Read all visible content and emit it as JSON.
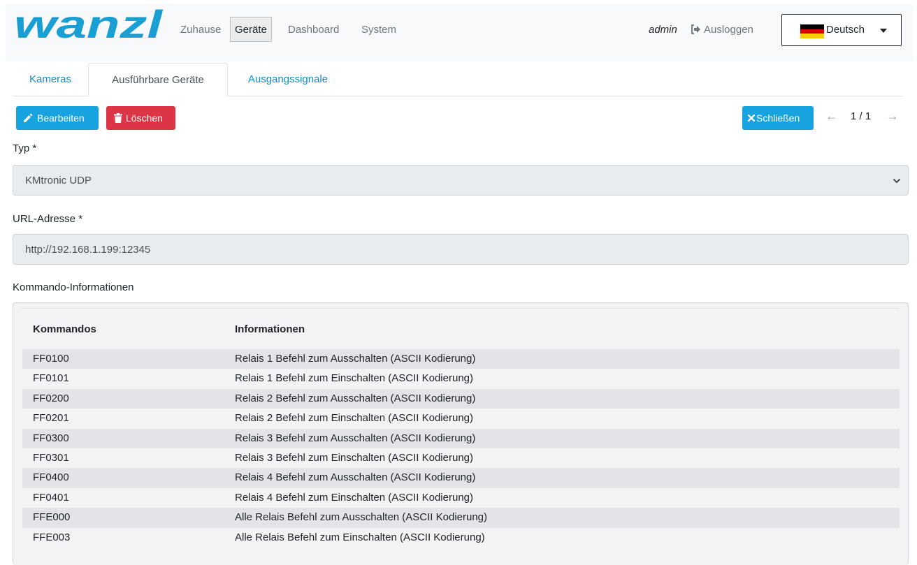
{
  "brand": {
    "logo_text": "wanzl",
    "color": "#1a9fd4"
  },
  "nav": {
    "links": [
      {
        "label": "Zuhause",
        "active": false
      },
      {
        "label": "Geräte",
        "active": true
      },
      {
        "label": "Dashboard",
        "active": false
      },
      {
        "label": "System",
        "active": false
      }
    ],
    "user": "admin",
    "logout_label": "Ausloggen",
    "language_label": "Deutsch"
  },
  "tabs": [
    {
      "label": "Kameras",
      "active": false
    },
    {
      "label": "Ausführbare Geräte",
      "active": true
    },
    {
      "label": "Ausgangssignale",
      "active": false
    }
  ],
  "toolbar": {
    "edit_label": "Bearbeiten",
    "delete_label": "Löschen",
    "close_label": "Schließen",
    "pager_text": "1 / 1"
  },
  "form": {
    "type_label": "Typ *",
    "type_value": "KMtronic UDP",
    "url_label": "URL-Adresse *",
    "url_value": "http://192.168.1.199:12345",
    "commands_label": "Kommando-Informationen"
  },
  "commands": {
    "headers": [
      "Kommandos",
      "Informationen"
    ],
    "rows": [
      {
        "cmd": "FF0100",
        "info": "Relais 1 Befehl zum Ausschalten (ASCII Kodierung)"
      },
      {
        "cmd": "FF0101",
        "info": "Relais 1 Befehl zum Einschalten (ASCII Kodierung)"
      },
      {
        "cmd": "FF0200",
        "info": "Relais 2 Befehl zum Ausschalten (ASCII Kodierung)"
      },
      {
        "cmd": "FF0201",
        "info": "Relais 2 Befehl zum Einschalten (ASCII Kodierung)"
      },
      {
        "cmd": "FF0300",
        "info": "Relais 3 Befehl zum Ausschalten (ASCII Kodierung)"
      },
      {
        "cmd": "FF0301",
        "info": "Relais 3 Befehl zum Einschalten (ASCII Kodierung)"
      },
      {
        "cmd": "FF0400",
        "info": "Relais 4 Befehl zum Ausschalten (ASCII Kodierung)"
      },
      {
        "cmd": "FF0401",
        "info": "Relais 4 Befehl zum Einschalten (ASCII Kodierung)"
      },
      {
        "cmd": "FFE000",
        "info": "Alle Relais Befehl zum Ausschalten (ASCII Kodierung)"
      },
      {
        "cmd": "FFE003",
        "info": "Alle Relais Befehl zum Einschalten (ASCII Kodierung)"
      }
    ]
  },
  "icons": {
    "edit": "pencil-icon",
    "delete": "trash-icon",
    "close": "close-icon",
    "logout": "sign-out-icon",
    "language": "flag-germany-icon",
    "select": "chevron-down-icon",
    "prev": "arrow-left-icon",
    "next": "arrow-right-icon"
  }
}
